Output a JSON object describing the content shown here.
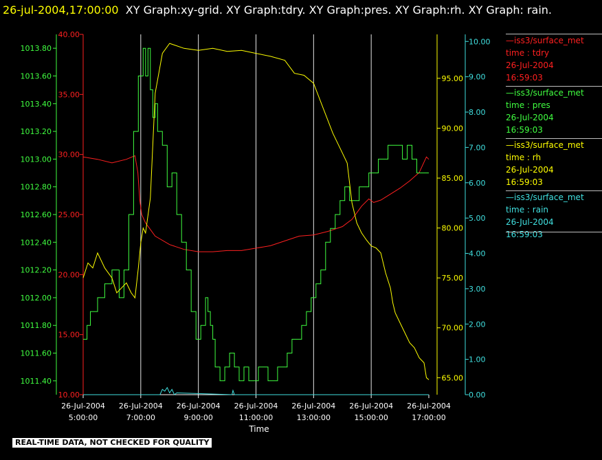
{
  "header": {
    "timestamp": "26-jul-2004,17:00:00",
    "graph_list": "XY Graph:xy-grid.  XY Graph:tdry.  XY Graph:pres.  XY Graph:rh.  XY Graph: rain."
  },
  "legend": [
    {
      "series": "—iss3/surface_met",
      "var": "time : tdry",
      "date": "26-Jul-2004",
      "time": "16:59:03",
      "color": "#ff2020"
    },
    {
      "series": "—iss3/surface_met",
      "var": "time : pres",
      "date": "26-Jul-2004",
      "time": "16:59:03",
      "color": "#40ff40"
    },
    {
      "series": "—iss3/surface_met",
      "var": "time : rh",
      "date": "26-Jul-2004",
      "time": "16:59:03",
      "color": "#ffff00"
    },
    {
      "series": "—iss3/surface_met",
      "var": "time : rain",
      "date": "26-Jul-2004",
      "time": "16:59:03",
      "color": "#40e0e0"
    }
  ],
  "notice": "REAL-TIME DATA, NOT CHECKED FOR QUALITY",
  "chart_data": {
    "type": "line",
    "xlabel": "Time",
    "x_ticks": [
      [
        "26-Jul-2004",
        "5:00:00"
      ],
      [
        "26-Jul-2004",
        "7:00:00"
      ],
      [
        "26-Jul-2004",
        "9:00:00"
      ],
      [
        "26-Jul-2004",
        "11:00:00"
      ],
      [
        "26-Jul-2004",
        "13:00:00"
      ],
      [
        "26-Jul-2004",
        "15:00:00"
      ],
      [
        "26-Jul-2004",
        "17:00:00"
      ]
    ],
    "xlim": [
      "05:00",
      "17:00"
    ],
    "grid": "vertical",
    "axes": {
      "tdry": {
        "side": "left-outer",
        "color": "#ff2020",
        "ylim": [
          10,
          40
        ],
        "ticks": [
          "10.00",
          "15.00",
          "20.00",
          "25.00",
          "30.00",
          "35.00",
          "40.00"
        ]
      },
      "pres": {
        "side": "left-inner",
        "color": "#40ff40",
        "ylim": [
          1011.3,
          1013.9
        ],
        "ticks": [
          "1011.40",
          "1011.60",
          "1011.80",
          "1012.00",
          "1012.20",
          "1012.40",
          "1012.60",
          "1012.80",
          "1013.00",
          "1013.20",
          "1013.40",
          "1013.60",
          "1013.80"
        ]
      },
      "rh": {
        "side": "right-inner",
        "color": "#ffff00",
        "ylim": [
          63.3,
          99.4
        ],
        "ticks": [
          "65.00",
          "70.00",
          "75.00",
          "80.00",
          "85.00",
          "90.00",
          "95.00"
        ]
      },
      "rain": {
        "side": "right-outer",
        "color": "#40e0e0",
        "ylim": [
          0,
          10.2
        ],
        "ticks": [
          "0.00",
          "1.00",
          "2.00",
          "3.00",
          "4.00",
          "5.00",
          "6.00",
          "7.00",
          "8.00",
          "9.00",
          "10.00"
        ]
      }
    },
    "series": [
      {
        "name": "tdry",
        "axis": "tdry",
        "x": [
          "05:00",
          "05:30",
          "06:00",
          "06:30",
          "06:48",
          "06:54",
          "06:58",
          "07:02",
          "07:10",
          "07:30",
          "08:00",
          "08:30",
          "09:00",
          "09:30",
          "10:00",
          "10:30",
          "11:00",
          "11:30",
          "12:00",
          "12:30",
          "13:00",
          "13:30",
          "14:00",
          "14:20",
          "14:40",
          "14:55",
          "15:05",
          "15:20",
          "15:40",
          "16:00",
          "16:20",
          "16:40",
          "16:55",
          "17:00"
        ],
        "values": [
          29.8,
          29.6,
          29.3,
          29.6,
          29.9,
          28.5,
          26.2,
          25.0,
          24.3,
          23.2,
          22.5,
          22.1,
          21.9,
          21.9,
          22.0,
          22.0,
          22.2,
          22.4,
          22.8,
          23.2,
          23.3,
          23.6,
          24.0,
          24.6,
          25.7,
          26.3,
          26.0,
          26.2,
          26.7,
          27.2,
          27.8,
          28.5,
          29.8,
          29.6
        ]
      },
      {
        "name": "pres",
        "axis": "pres",
        "x": [
          "05:00",
          "05:08",
          "05:15",
          "05:30",
          "05:45",
          "06:00",
          "06:15",
          "06:25",
          "06:35",
          "06:45",
          "06:55",
          "07:05",
          "07:10",
          "07:15",
          "07:20",
          "07:25",
          "07:30",
          "07:35",
          "07:45",
          "07:55",
          "08:05",
          "08:15",
          "08:25",
          "08:35",
          "08:45",
          "08:55",
          "09:05",
          "09:15",
          "09:20",
          "09:25",
          "09:30",
          "09:35",
          "09:45",
          "09:55",
          "10:05",
          "10:15",
          "10:25",
          "10:35",
          "10:45",
          "10:55",
          "11:05",
          "11:15",
          "11:25",
          "11:35",
          "11:45",
          "11:55",
          "12:05",
          "12:15",
          "12:25",
          "12:35",
          "12:45",
          "12:55",
          "13:05",
          "13:15",
          "13:25",
          "13:35",
          "13:45",
          "13:55",
          "14:05",
          "14:15",
          "14:25",
          "14:35",
          "14:45",
          "14:55",
          "15:05",
          "15:15",
          "15:25",
          "15:35",
          "15:45",
          "15:55",
          "16:05",
          "16:15",
          "16:25",
          "16:35",
          "16:45",
          "16:55",
          "17:00"
        ],
        "values": [
          1011.7,
          1011.8,
          1011.9,
          1012.0,
          1012.1,
          1012.2,
          1012.0,
          1012.2,
          1012.6,
          1013.2,
          1013.6,
          1013.8,
          1013.6,
          1013.8,
          1013.5,
          1013.3,
          1013.4,
          1013.2,
          1013.1,
          1012.8,
          1012.9,
          1012.6,
          1012.4,
          1012.2,
          1011.9,
          1011.7,
          1011.8,
          1012.0,
          1011.9,
          1011.8,
          1011.7,
          1011.5,
          1011.4,
          1011.5,
          1011.6,
          1011.5,
          1011.4,
          1011.5,
          1011.4,
          1011.4,
          1011.5,
          1011.5,
          1011.4,
          1011.4,
          1011.5,
          1011.5,
          1011.6,
          1011.7,
          1011.7,
          1011.8,
          1011.9,
          1012.0,
          1012.1,
          1012.2,
          1012.4,
          1012.5,
          1012.6,
          1012.7,
          1012.8,
          1012.7,
          1012.7,
          1012.8,
          1012.8,
          1012.9,
          1012.9,
          1013.0,
          1013.0,
          1013.1,
          1013.1,
          1013.1,
          1013.0,
          1013.1,
          1013.0,
          1012.9,
          1012.9,
          1012.9,
          1012.9
        ]
      },
      {
        "name": "rh",
        "axis": "rh",
        "x": [
          "05:00",
          "05:10",
          "05:20",
          "05:30",
          "05:45",
          "06:00",
          "06:10",
          "06:20",
          "06:30",
          "06:40",
          "06:48",
          "06:55",
          "07:00",
          "07:05",
          "07:10",
          "07:20",
          "07:30",
          "07:45",
          "08:00",
          "08:30",
          "09:00",
          "09:30",
          "10:00",
          "10:30",
          "11:00",
          "11:30",
          "12:00",
          "12:20",
          "12:40",
          "13:00",
          "13:20",
          "13:40",
          "13:50",
          "14:00",
          "14:10",
          "14:15",
          "14:20",
          "14:25",
          "14:30",
          "14:40",
          "14:50",
          "15:00",
          "15:10",
          "15:20",
          "15:30",
          "15:40",
          "15:45",
          "15:50",
          "16:00",
          "16:10",
          "16:20",
          "16:30",
          "16:40",
          "16:50",
          "16:55",
          "17:00"
        ],
        "values": [
          75.0,
          76.5,
          76.0,
          77.5,
          76.0,
          75.0,
          73.5,
          74.0,
          74.5,
          73.5,
          73.0,
          76.0,
          78.5,
          80.0,
          79.5,
          83.0,
          93.5,
          97.5,
          98.5,
          98.0,
          97.8,
          98.0,
          97.7,
          97.8,
          97.5,
          97.2,
          96.8,
          95.5,
          95.3,
          94.5,
          92.0,
          89.5,
          88.5,
          87.5,
          86.5,
          84.5,
          82.5,
          81.5,
          80.5,
          79.5,
          78.8,
          78.2,
          78.0,
          77.5,
          75.5,
          74.0,
          72.5,
          71.5,
          70.5,
          69.5,
          68.5,
          68.0,
          67.0,
          66.5,
          65.0,
          64.8
        ]
      },
      {
        "name": "rain",
        "axis": "rain",
        "x": [
          "05:00",
          "07:40",
          "07:45",
          "07:50",
          "07:55",
          "08:00",
          "08:05",
          "08:10",
          "08:15",
          "10:10",
          "10:12",
          "10:15",
          "17:00"
        ],
        "values": [
          0.0,
          0.0,
          0.15,
          0.1,
          0.2,
          0.05,
          0.15,
          0.0,
          0.05,
          0.0,
          0.12,
          0.0,
          0.0
        ]
      }
    ]
  }
}
